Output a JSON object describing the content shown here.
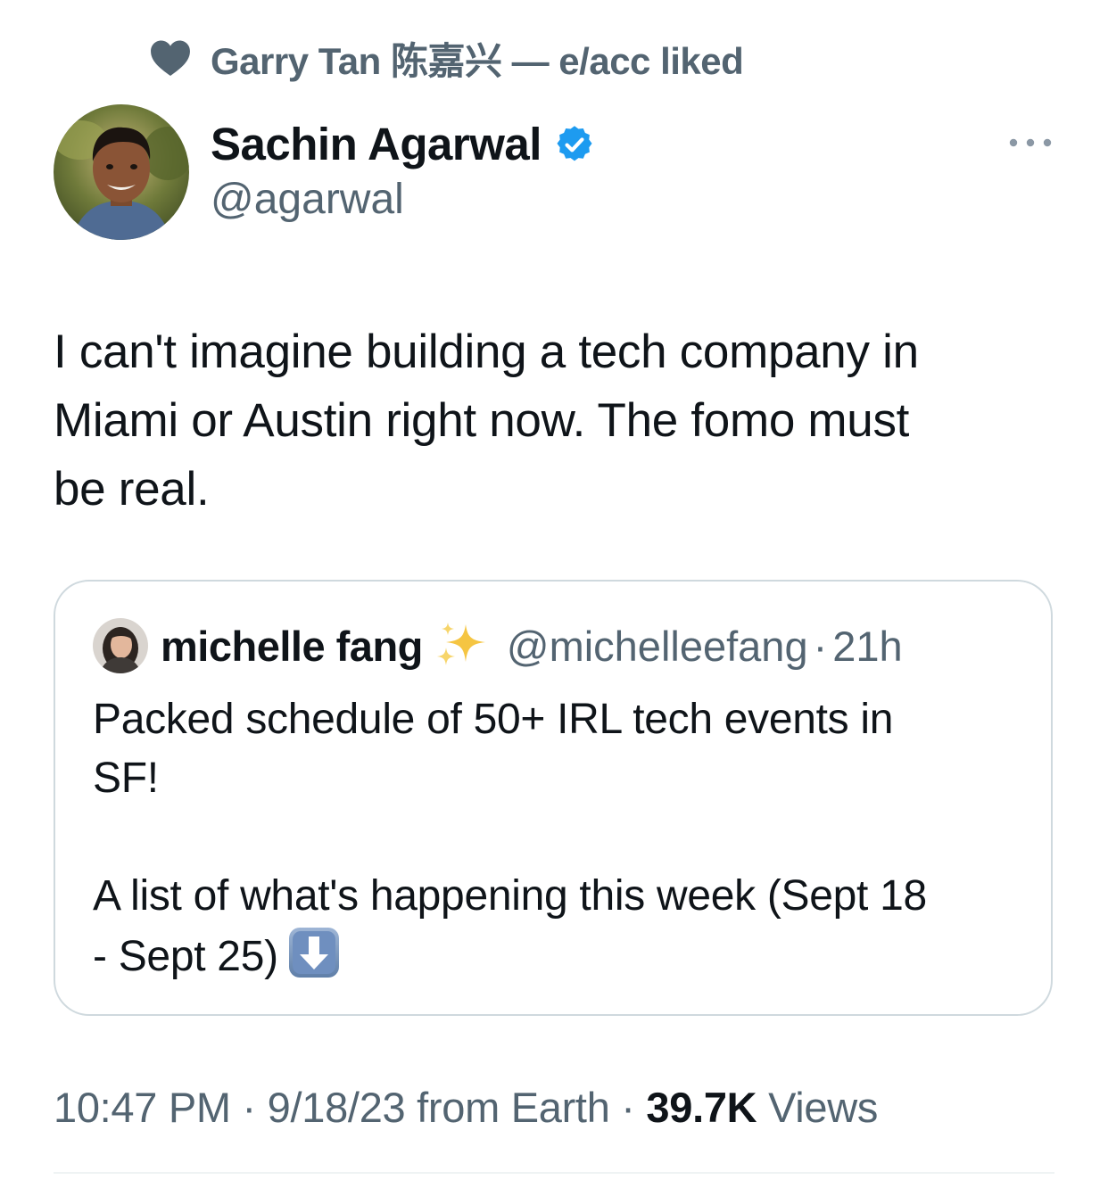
{
  "social_context": {
    "icon": "heart-icon",
    "text": "Garry Tan 陈嘉兴 — e/acc liked"
  },
  "tweet": {
    "author": {
      "name": "Sachin Agarwal",
      "handle": "@agarwal",
      "verified": true,
      "verified_color": "#1d9bf0"
    },
    "text_lines": [
      "I can't imagine building a tech company in",
      "Miami or Austin right now. The fomo must",
      "be real."
    ],
    "quoted": {
      "name": "michelle fang",
      "name_emoji": "sparkles-icon",
      "handle": "@michelleefang",
      "separator": "·",
      "time": "21h",
      "text_lines_1": [
        "Packed schedule of 50+ IRL tech events in",
        "SF!"
      ],
      "text_lines_2": [
        "A list of what's happening this week (Sept 18",
        "- Sept 25)"
      ],
      "trailing_emoji": "down-arrow-icon"
    },
    "meta": {
      "time": "10:47 PM",
      "sep1": " · ",
      "date": "9/18/23",
      "source": " from Earth",
      "sep2": " · ",
      "views_count": "39.7K",
      "views_label": " Views"
    }
  },
  "colors": {
    "text": "#0f1419",
    "secondary": "#536471",
    "border": "#cfd9de",
    "accent": "#1d9bf0"
  }
}
